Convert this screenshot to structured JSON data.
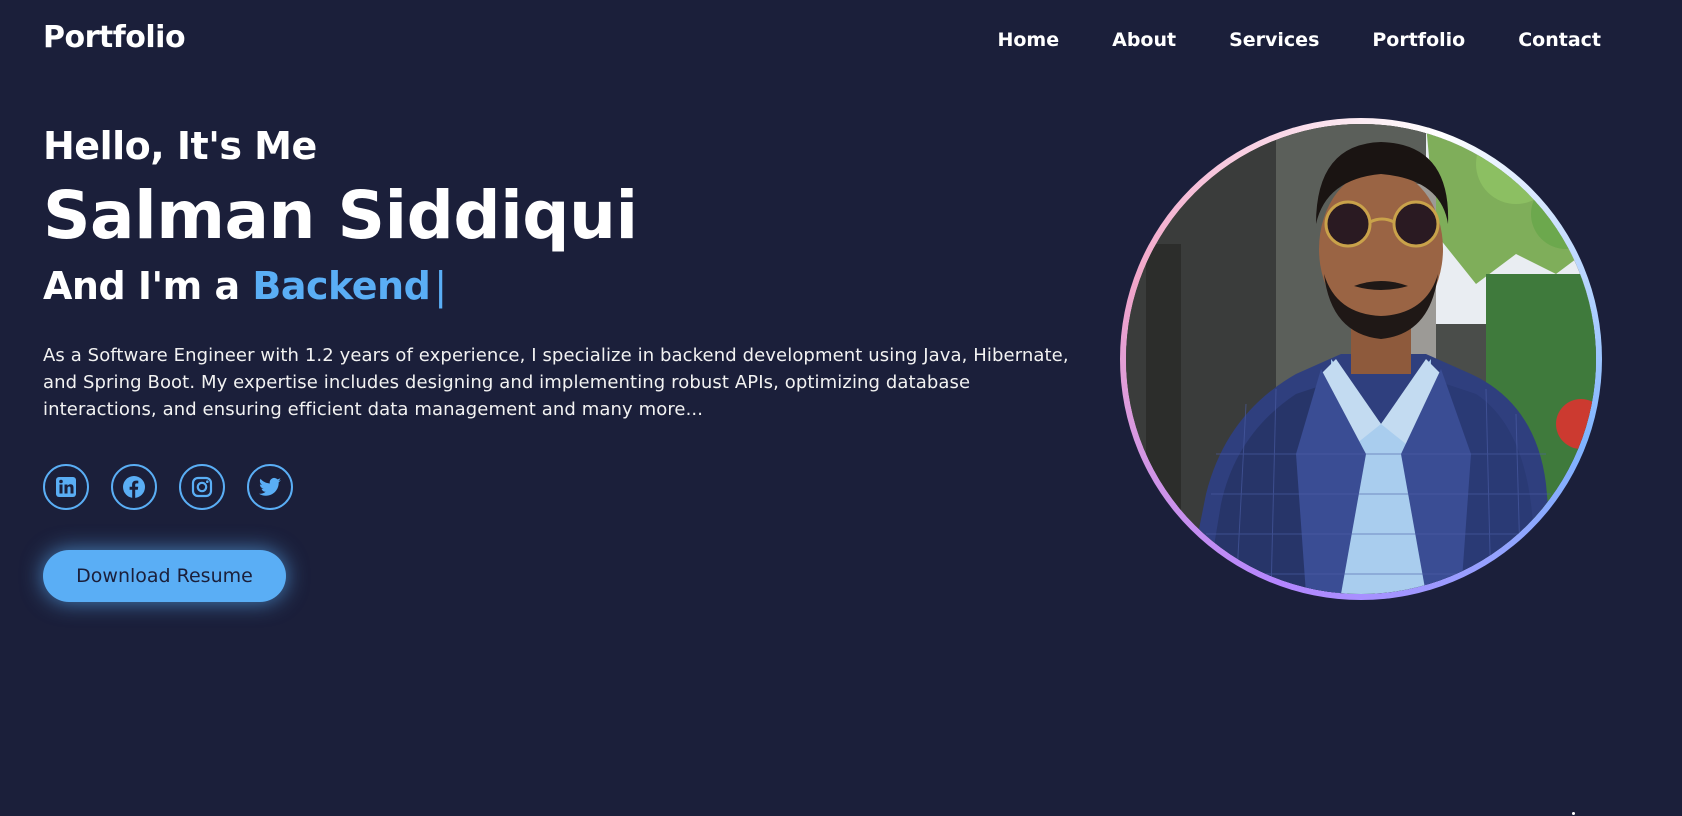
{
  "header": {
    "logo": "Portfolio",
    "nav": [
      {
        "label": "Home"
      },
      {
        "label": "About"
      },
      {
        "label": "Services"
      },
      {
        "label": "Portfolio"
      },
      {
        "label": "Contact"
      }
    ]
  },
  "hero": {
    "greeting": "Hello, It's Me",
    "name": "Salman Siddiqui",
    "role_prefix": "And I'm a",
    "role_highlight": "Backend",
    "cursor": "|",
    "description": "As a Software Engineer with 1.2 years of experience, I specialize in backend development using Java, Hibernate, and Spring Boot. My expertise includes designing and implementing robust APIs, optimizing database interactions, and ensuring efficient data management and many more...",
    "button_label": "Download Resume"
  },
  "socials": [
    {
      "icon": "linkedin-icon"
    },
    {
      "icon": "facebook-icon"
    },
    {
      "icon": "instagram-icon"
    },
    {
      "icon": "twitter-icon"
    }
  ],
  "profile_image": {
    "icon": "profile-photo"
  },
  "colors": {
    "background": "#1b1f3a",
    "accent": "#5aaef5",
    "text": "#ffffff"
  }
}
